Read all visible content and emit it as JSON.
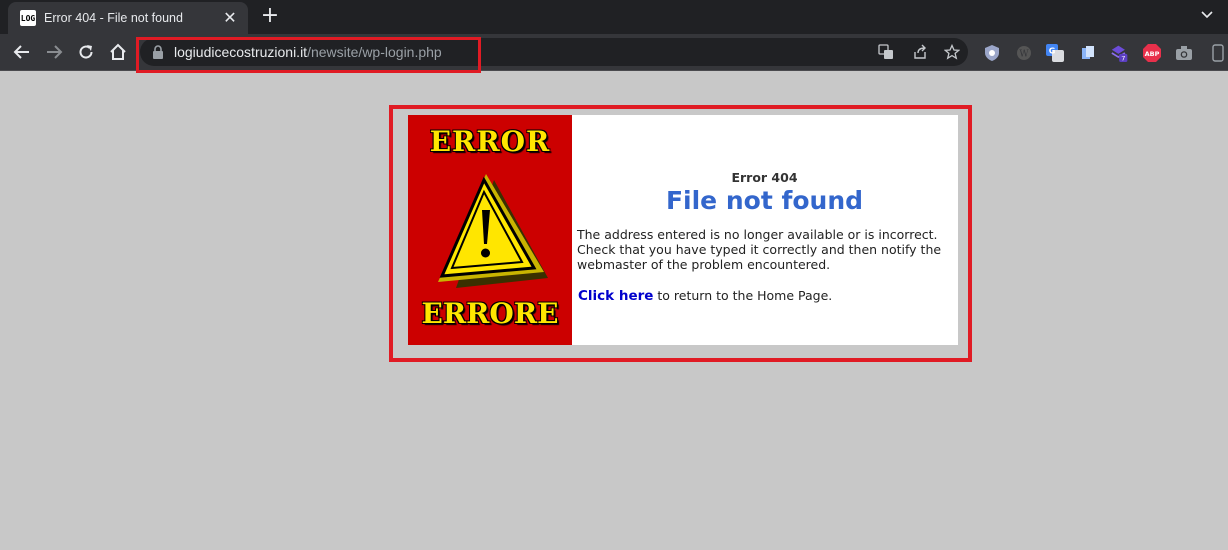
{
  "tab": {
    "favicon_text": "LOG",
    "title": "Error 404 - File not found",
    "close_glyph": "✕",
    "new_tab_glyph": "+"
  },
  "toolbar": {
    "url_host": "logiudicecostruzioni.it",
    "url_path": "/newsite/wp-login.php",
    "extensions": [
      "shield-extension-icon",
      "wordpress-extension-icon",
      "google-translate-extension-icon",
      "documents-extension-icon",
      "stack-extension-icon",
      "adblock-plus-extension-icon",
      "camera-extension-icon"
    ],
    "ext_badge": "7",
    "abp_label": "ABP"
  },
  "page": {
    "image_top_word": "ERROR",
    "image_bottom_word": "ERRORE",
    "error_code": "Error 404",
    "error_title": "File not found",
    "description": "The address entered is no longer available or is incorrect. Check that you have typed it correctly and then notify the webmaster of the problem encountered.",
    "link_label": "Click here",
    "link_suffix": " to return to the Home Page."
  },
  "colors": {
    "highlight": "#e01b24",
    "title_blue": "#3366cc",
    "link_blue": "#0000cc",
    "image_red": "#cc0000",
    "warning_yellow": "#ffe600"
  }
}
